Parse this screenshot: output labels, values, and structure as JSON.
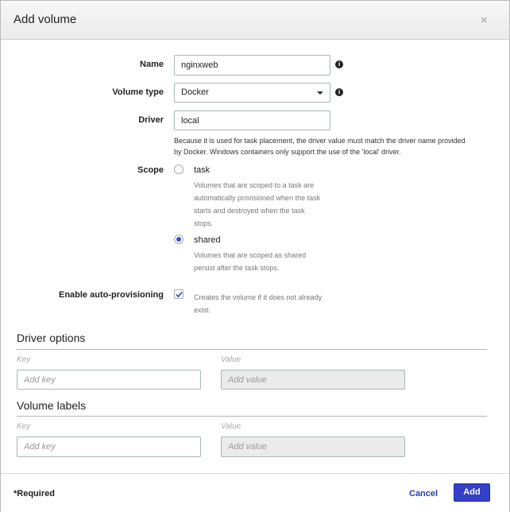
{
  "dialog": {
    "title": "Add volume",
    "close_glyph": "×"
  },
  "form": {
    "name_label": "Name",
    "name_value": "nginxweb",
    "volume_type_label": "Volume type",
    "volume_type_value": "Docker",
    "driver_label": "Driver",
    "driver_value": "local",
    "driver_help_line1": "Because it is used for task placement, the driver value must match the driver name provided",
    "driver_help_line2": "by Docker. Windows containers only support the use of the 'local' driver.",
    "scope_label": "Scope",
    "scope_options": [
      {
        "label": "task",
        "checked": false,
        "desc_lines": [
          "Volumes that are scoped to a task are",
          "automatically provisioned when the task",
          "starts and destroyed when the task",
          "stops."
        ]
      },
      {
        "label": "shared",
        "checked": true,
        "desc_lines": [
          "Volumes that are scoped as shared",
          "persist after the task stops."
        ]
      }
    ],
    "auto_provision_label": "Enable auto-provisioning",
    "auto_provision_checked": true,
    "auto_provision_help_lines": [
      "Creates the volume if it does not already",
      "exist."
    ]
  },
  "driver_options": {
    "title": "Driver options",
    "key_header": "Key",
    "value_header": "Value",
    "key_placeholder": "Add key",
    "value_placeholder": "Add value"
  },
  "volume_labels": {
    "title": "Volume labels",
    "key_header": "Key",
    "value_header": "Value",
    "key_placeholder": "Add key",
    "value_placeholder": "Add value"
  },
  "footer": {
    "required_text": "*Required",
    "cancel_label": "Cancel",
    "add_label": "Add"
  },
  "icons": {
    "info": "info-icon",
    "close": "close-icon",
    "caret": "chevron-down-icon",
    "check": "checkmark-icon"
  },
  "colors": {
    "primary": "#3340c7",
    "link": "#2541b2",
    "radio_selected": "#3b4bd3"
  }
}
